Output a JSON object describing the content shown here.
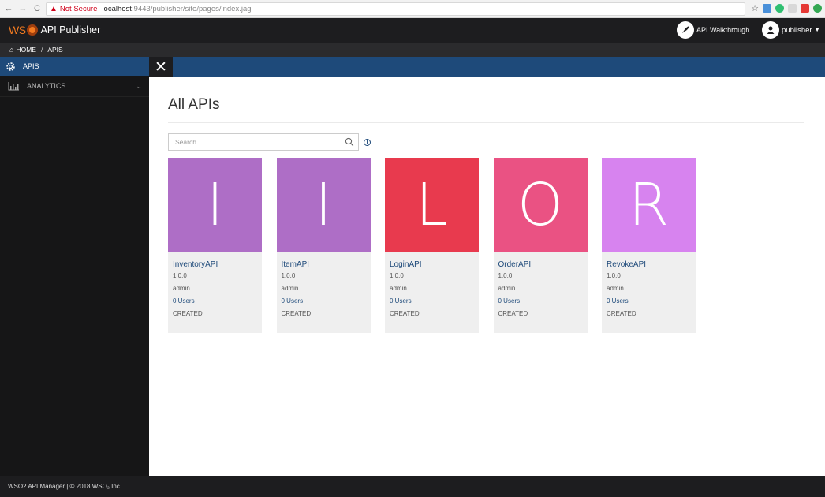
{
  "browser": {
    "back_icon": "←",
    "forward_icon": "→",
    "reload_icon": "C",
    "security_warning": "Not Secure",
    "url_host": "localhost",
    "url_path": ":9443/publisher/site/pages/index.jag",
    "extension_colors": [
      "#4a90d9",
      "#2fbf71",
      "#d8d8d8",
      "#e53935",
      "#34a853"
    ]
  },
  "header": {
    "logo_wso": "WS",
    "logo_text": "API Publisher",
    "walkthrough_label": "API Walkthrough",
    "user_label": "publisher"
  },
  "breadcrumb": {
    "home": "HOME",
    "separator": "/",
    "current": "APIS"
  },
  "sidebar": {
    "items": [
      {
        "label": "APIS",
        "active": true
      },
      {
        "label": "ANALYTICS",
        "active": false
      }
    ]
  },
  "main": {
    "title": "All APIs",
    "search_placeholder": "Search"
  },
  "apis": [
    {
      "letter": "I",
      "name": "InventoryAPI",
      "version": "1.0.0",
      "owner": "admin",
      "users": "0 Users",
      "status": "CREATED",
      "color": "#ae6ec6"
    },
    {
      "letter": "I",
      "name": "ItemAPI",
      "version": "1.0.0",
      "owner": "admin",
      "users": "0 Users",
      "status": "CREATED",
      "color": "#ae6ec6"
    },
    {
      "letter": "L",
      "name": "LoginAPI",
      "version": "1.0.0",
      "owner": "admin",
      "users": "0 Users",
      "status": "CREATED",
      "color": "#e83a4e"
    },
    {
      "letter": "O",
      "name": "OrderAPI",
      "version": "1.0.0",
      "owner": "admin",
      "users": "0 Users",
      "status": "CREATED",
      "color": "#ea5283"
    },
    {
      "letter": "R",
      "name": "RevokeAPI",
      "version": "1.0.0",
      "owner": "admin",
      "users": "0 Users",
      "status": "CREATED",
      "color": "#d783ef"
    }
  ],
  "footer": {
    "text": "WSO2 API Manager | © 2018 WSO₂ Inc."
  },
  "colors": {
    "accent": "#1e4a7a",
    "brand_orange": "#f47b20"
  }
}
